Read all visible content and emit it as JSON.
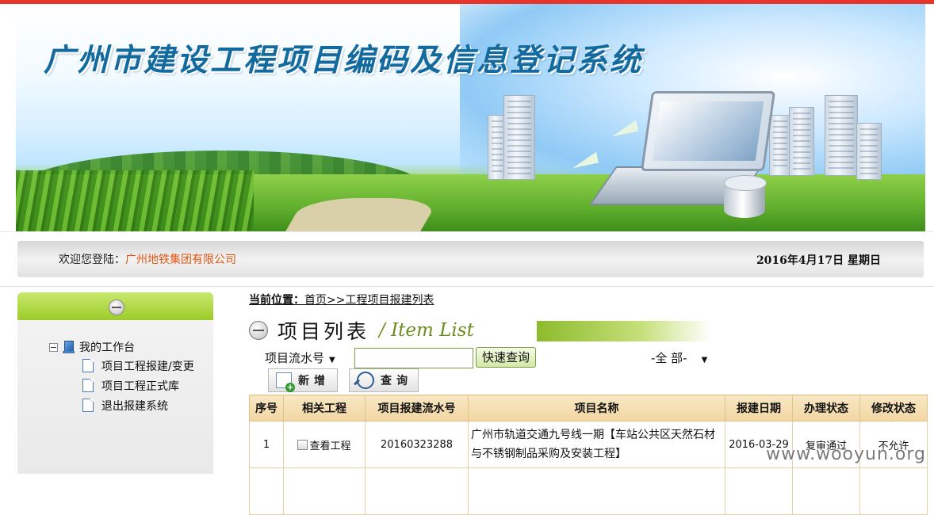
{
  "header": {
    "title": "广州市建设工程项目编码及信息登记系统"
  },
  "welcome": {
    "prefix": "欢迎您登陆：",
    "company": "广州地铁集团有限公司",
    "date": "2016年4月17日  星期日"
  },
  "sidebar": {
    "root_label": "我的工作台",
    "items": [
      {
        "label": "项目工程报建/变更"
      },
      {
        "label": "项目工程正式库"
      },
      {
        "label": "退出报建系统"
      }
    ]
  },
  "breadcrumb": {
    "label": "当前位置：",
    "home": "首页",
    "current": ">>工程项目报建列表"
  },
  "list": {
    "title_cn": "项目列表",
    "title_en": "/ Item  List"
  },
  "search": {
    "field_select": "项目流水号",
    "input_value": "",
    "quick_query_label": "快速查询",
    "status_select": "-全 部-"
  },
  "toolbar": {
    "add_label": "新增",
    "query_label": "查询"
  },
  "table": {
    "headers": [
      "序号",
      "相关工程",
      "项目报建流水号",
      "项目名称",
      "报建日期",
      "办理状态",
      "修改状态"
    ],
    "rows": [
      {
        "index": "1",
        "related": "查看工程",
        "serial": "20160323288",
        "name": "广州市轨道交通九号线一期【车站公共区天然石材与不锈钢制品采购及安装工程】",
        "date": "2016-03-29",
        "status": "复审通过",
        "modify": "不允许"
      }
    ]
  },
  "watermark": "www.wooyun.org",
  "colors": {
    "topbar": "#e8352c",
    "sidebar_header": "#9ccc2a",
    "company_text": "#e2550e",
    "table_header": "#f2d6a2"
  }
}
